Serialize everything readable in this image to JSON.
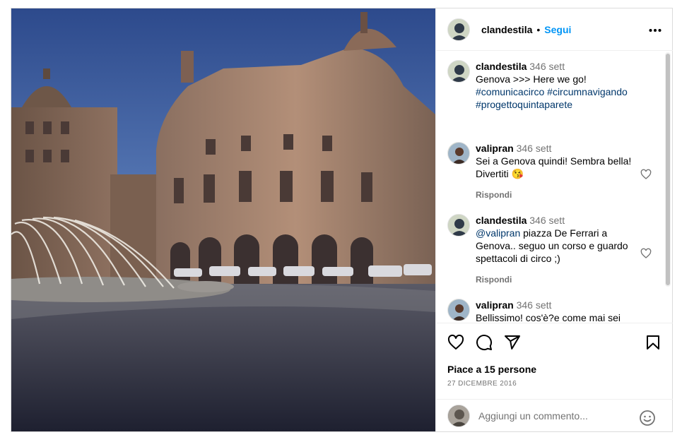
{
  "header": {
    "username": "clandestila",
    "separator": "•",
    "follow_label": "Segui",
    "more_label": "•••"
  },
  "caption": {
    "username": "clandestila",
    "time": "346 sett",
    "text": "Genova >>> Here we go!",
    "hashtags": [
      "#comunicacirco",
      "#circumnavigando",
      "#progettoquintaparete"
    ]
  },
  "comments": [
    {
      "username": "valipran",
      "time": "346 sett",
      "text": "Sei a Genova quindi! Sembra bella! Divertiti",
      "emoji": "😘",
      "reply_label": "Rispondi"
    },
    {
      "username": "clandestila",
      "time": "346 sett",
      "mention": "@valipran",
      "text": " piazza De Ferrari a Genova.. seguo un corso e guardo spettacoli di circo ;)",
      "reply_label": "Rispondi"
    },
    {
      "username": "valipran",
      "time": "346 sett",
      "text": "Bellissimo! cos'è?e come mai sei"
    }
  ],
  "actions": {
    "icons": [
      "heart-icon",
      "comment-icon",
      "share-icon",
      "bookmark-icon"
    ],
    "likes_text": "Piace a 15 persone",
    "date_text": "27 DICEMBRE 2016"
  },
  "add_comment": {
    "placeholder": "Aggiungi un commento...",
    "emoji_icon": "smiley-icon"
  },
  "colors": {
    "link_blue": "#0095f6",
    "hashtag": "#00376b",
    "muted": "#737373"
  }
}
